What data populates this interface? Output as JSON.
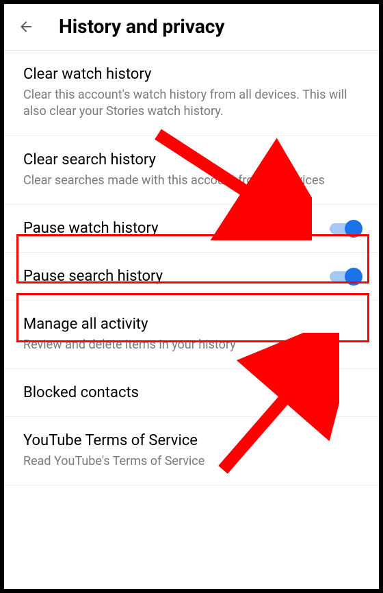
{
  "header": {
    "title": "History and privacy"
  },
  "items": {
    "clearWatch": {
      "title": "Clear watch history",
      "desc": "Clear this account's watch history from all devices. This will also clear your Stories watch history."
    },
    "clearSearch": {
      "title": "Clear search history",
      "desc": "Clear searches made with this account from all devices"
    },
    "pauseWatch": {
      "title": "Pause watch history"
    },
    "pauseSearch": {
      "title": "Pause search history"
    },
    "manageActivity": {
      "title": "Manage all activity",
      "desc": "Review and delete items in your history"
    },
    "blockedContacts": {
      "title": "Blocked contacts"
    },
    "terms": {
      "title": "YouTube Terms of Service",
      "desc": "Read YouTube's Terms of Service"
    }
  },
  "annotations": {
    "arrowColor": "#ff0000"
  }
}
